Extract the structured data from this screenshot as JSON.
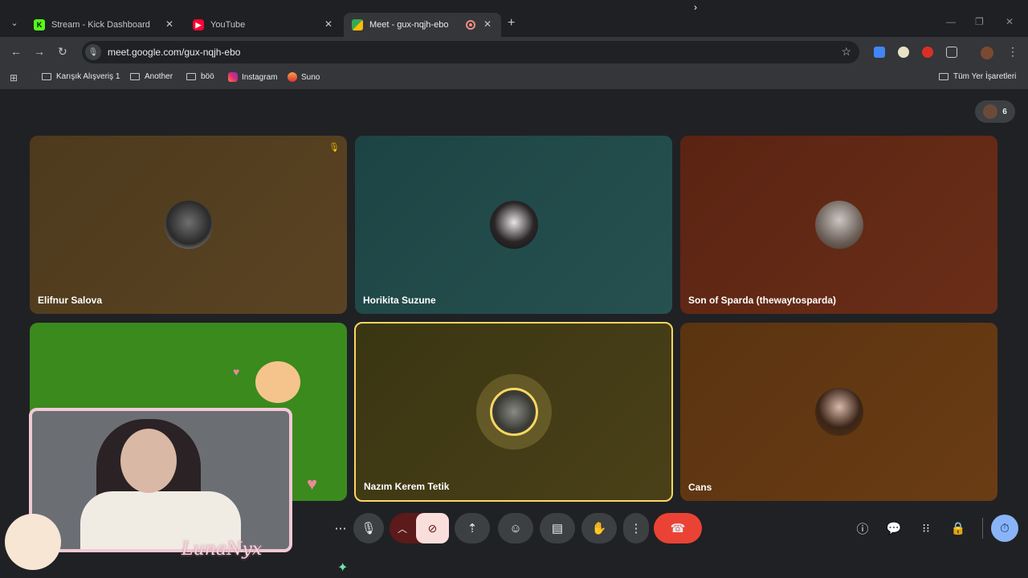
{
  "browser": {
    "tabs": [
      {
        "title": "Stream - Kick Dashboard",
        "active": false,
        "favicon": "kick-icon"
      },
      {
        "title": "YouTube",
        "active": false,
        "favicon": "youtube-icon"
      },
      {
        "title": "Meet - gux-nqjh-ebo",
        "active": true,
        "favicon": "meet-icon"
      }
    ],
    "url": "meet.google.com/gux-nqjh-ebo",
    "bookmarks": [
      "Karışık Alışveriş 1",
      "Another",
      "böö",
      "Instagram",
      "Suno"
    ],
    "all_bookmarks": "Tüm Yer İşaretleri"
  },
  "meet": {
    "participant_count": "6",
    "participants": [
      {
        "name": "Elifnur Salova",
        "muted": true
      },
      {
        "name": "Horikita Suzune",
        "muted": false
      },
      {
        "name": "Son of Sparda (thewaytosparda)",
        "muted": false
      },
      {
        "name": "",
        "muted": false
      },
      {
        "name": "Nazım Kerem Tetik",
        "muted": false,
        "speaking": true
      },
      {
        "name": "Cans",
        "muted": false
      }
    ]
  },
  "overlay": {
    "logo_text": "LunaNyx"
  },
  "colors": {
    "accent_yellow": "#fdd663",
    "leave_red": "#ea4335",
    "camera_off_pink": "#f9dedc"
  }
}
